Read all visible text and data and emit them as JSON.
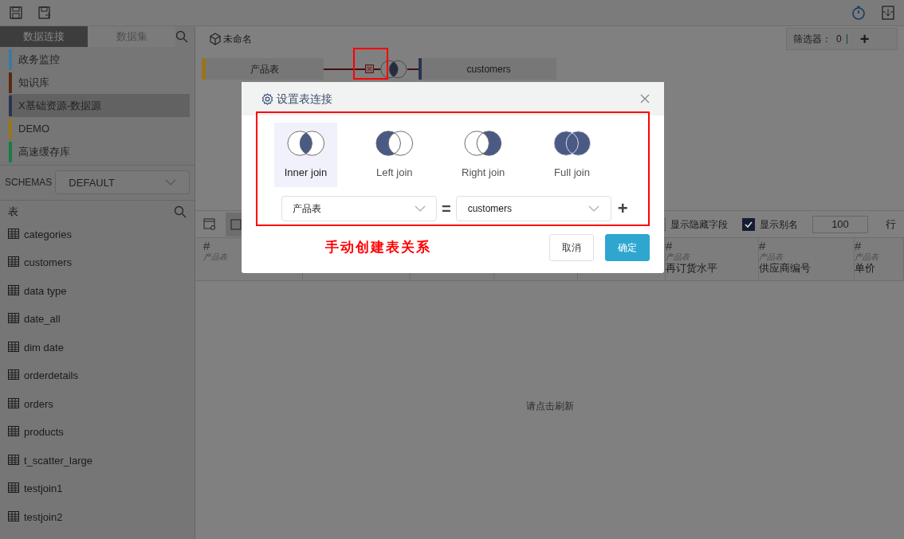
{
  "sidebar": {
    "tabs": [
      {
        "label": "数据连接",
        "selected": true
      },
      {
        "label": "数据集",
        "selected": false
      }
    ],
    "connections": [
      {
        "name": "政务监控",
        "color": "#3c78a6",
        "selected": false
      },
      {
        "name": "知识库",
        "color": "#5a2a0c",
        "selected": false
      },
      {
        "name": "X基础资源-数据源",
        "color": "#2a3450",
        "selected": true
      },
      {
        "name": "DEMO",
        "color": "#9a7418",
        "selected": false
      },
      {
        "name": "高速缓存库",
        "color": "#1b7a45",
        "selected": false
      }
    ],
    "schemas": {
      "label": "SCHEMAS",
      "value": "DEFAULT"
    },
    "tables_title": "表",
    "tables": [
      "categories",
      "customers",
      "data type",
      "date_all",
      "dim date",
      "orderdetails",
      "orders",
      "products",
      "t_scatter_large",
      "testjoin1",
      "testjoin2"
    ]
  },
  "workspace": {
    "title": "未命名",
    "filter": {
      "label": "筛选器：",
      "count": "0",
      "add": "+"
    },
    "diagram": {
      "left": {
        "name": "产品表",
        "color": "#9a7418"
      },
      "right": {
        "name": "customers",
        "color": "#2a3450"
      }
    },
    "grid": {
      "options": [
        {
          "label": "显示隐藏字段",
          "checked": false
        },
        {
          "label": "显示别名",
          "checked": true
        }
      ],
      "row_limit": "100",
      "row_unit": "行",
      "first_column": {
        "type": "#",
        "table": "产品表"
      },
      "columns": [
        {
          "type": "#",
          "table": "产品表",
          "name": "再订货水平"
        },
        {
          "type": "#",
          "table": "产品表",
          "name": "供应商编号"
        },
        {
          "type": "#",
          "table": "产品表",
          "name": "单价"
        }
      ],
      "empty_message": "请点击刷新"
    }
  },
  "dialog": {
    "title": "设置表连接",
    "joins": [
      {
        "kind": "inner",
        "label": "Inner join",
        "selected": true
      },
      {
        "kind": "left",
        "label": "Left join",
        "selected": false
      },
      {
        "kind": "right",
        "label": "Right join",
        "selected": false
      },
      {
        "kind": "full",
        "label": "Full join",
        "selected": false
      }
    ],
    "left_field": "产品表",
    "operator": "=",
    "right_field": "customers",
    "add": "+",
    "annotation": "手动创建表关系",
    "buttons": [
      {
        "kind": "cancel",
        "label": "取消"
      },
      {
        "kind": "confirm",
        "label": "确定"
      }
    ]
  }
}
